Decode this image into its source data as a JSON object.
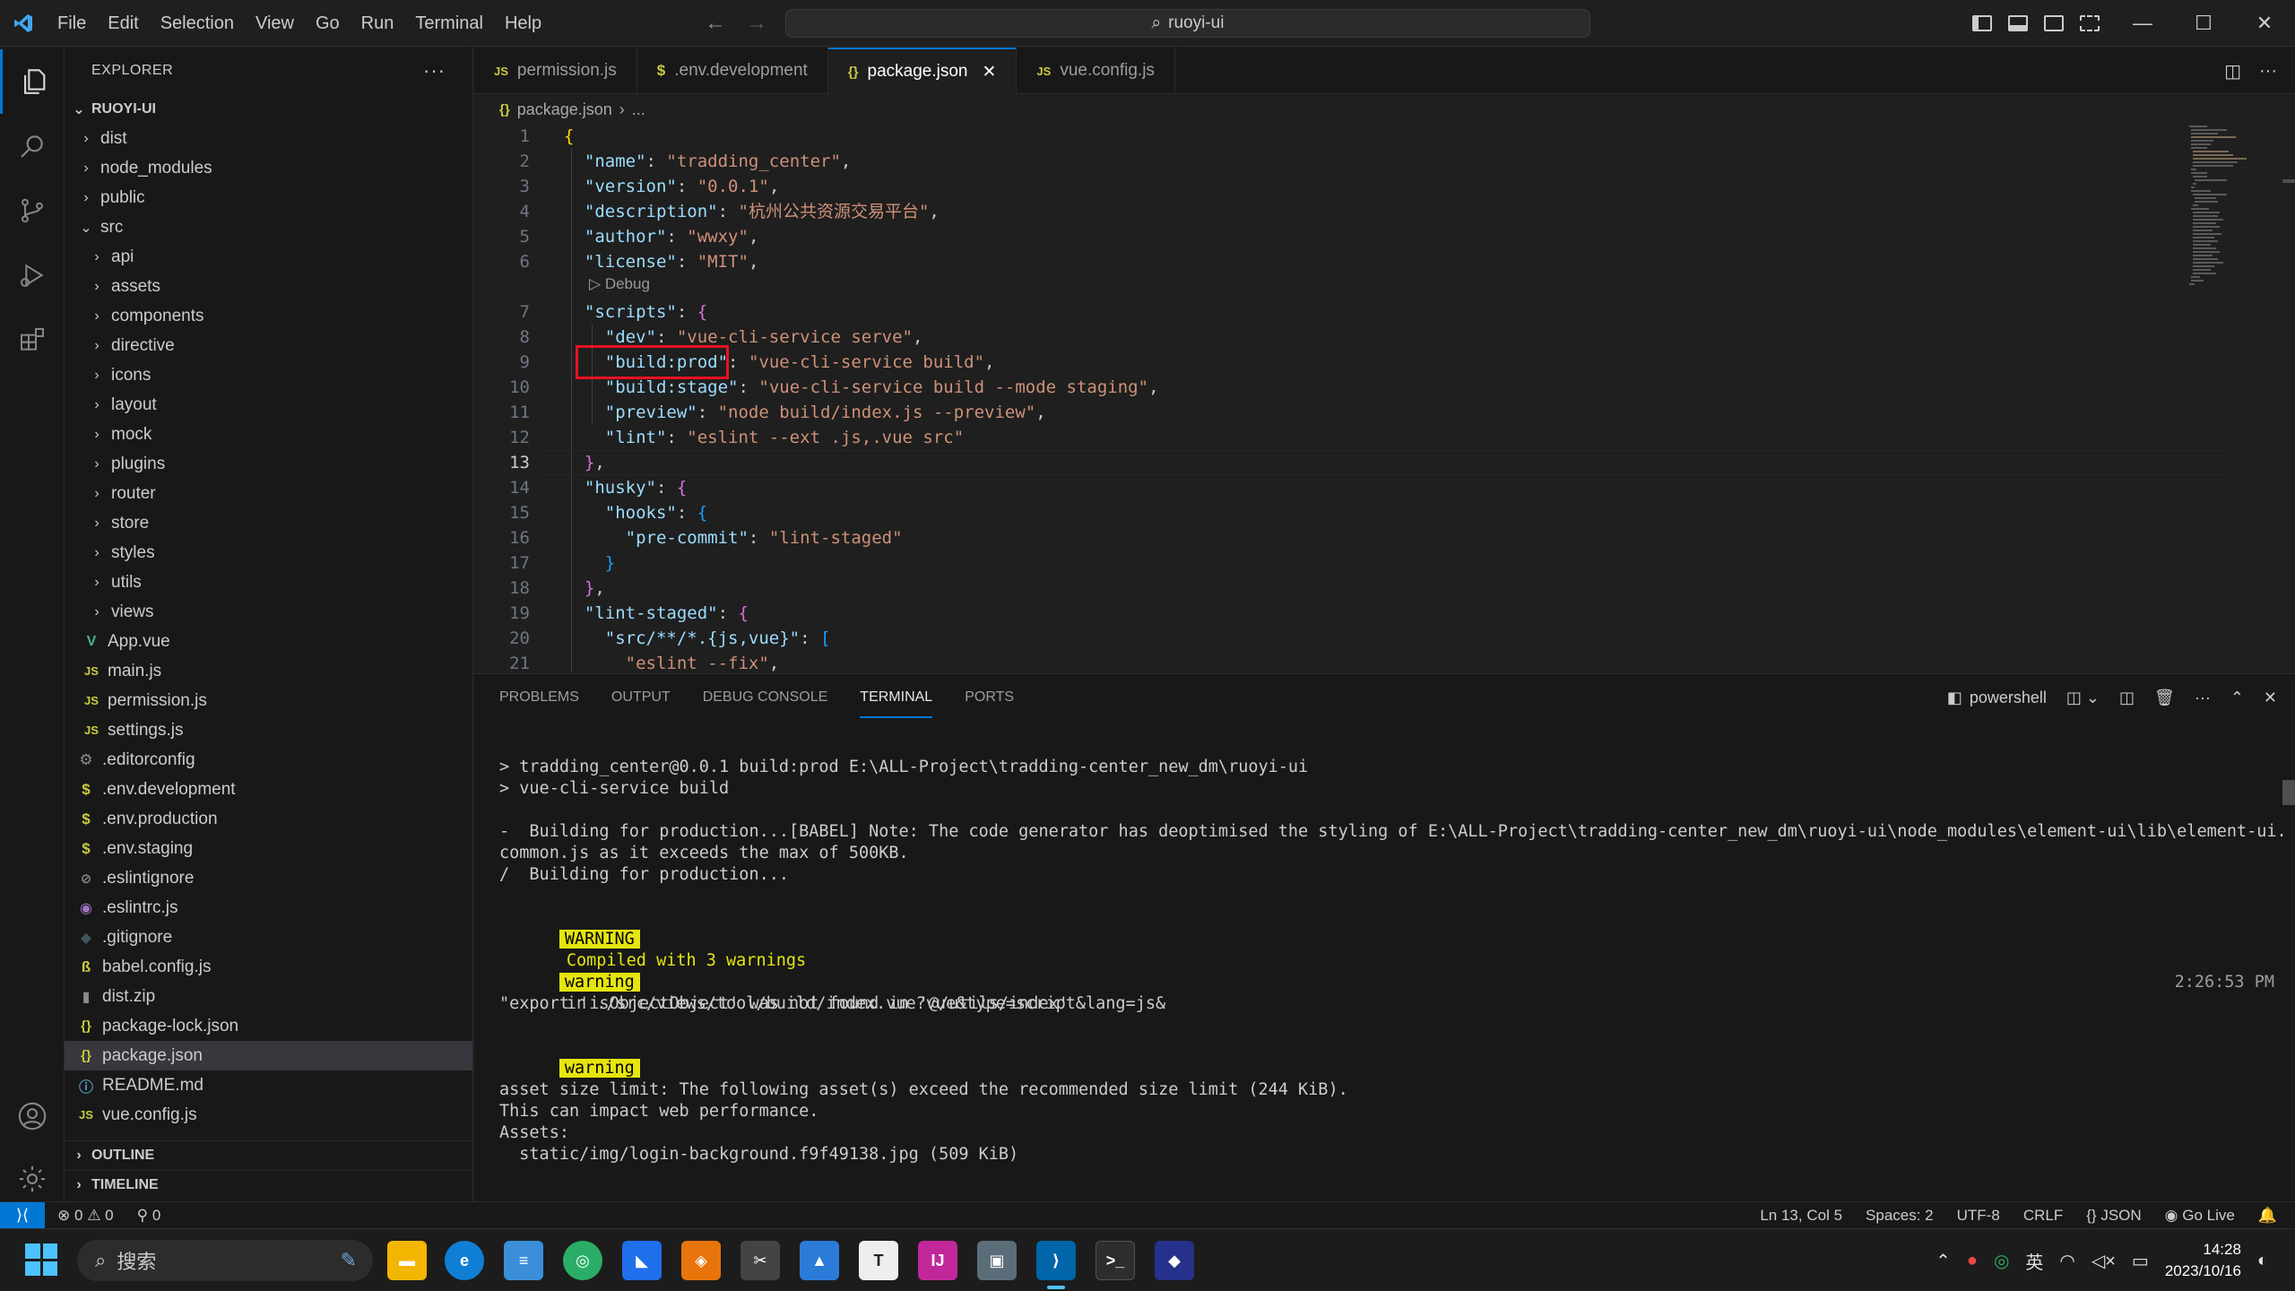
{
  "titlebar": {
    "menu": [
      "File",
      "Edit",
      "Selection",
      "View",
      "Go",
      "Run",
      "Terminal",
      "Help"
    ],
    "search_text": "ruoyi-ui"
  },
  "sidebar": {
    "title": "EXPLORER",
    "root": "RUOYI-UI",
    "items": [
      {
        "label": "dist",
        "type": "folder",
        "depth": 1
      },
      {
        "label": "node_modules",
        "type": "folder",
        "depth": 1
      },
      {
        "label": "public",
        "type": "folder",
        "depth": 1
      },
      {
        "label": "src",
        "type": "folder-open",
        "depth": 1
      },
      {
        "label": "api",
        "type": "folder",
        "depth": 2
      },
      {
        "label": "assets",
        "type": "folder",
        "depth": 2
      },
      {
        "label": "components",
        "type": "folder",
        "depth": 2
      },
      {
        "label": "directive",
        "type": "folder",
        "depth": 2
      },
      {
        "label": "icons",
        "type": "folder",
        "depth": 2
      },
      {
        "label": "layout",
        "type": "folder",
        "depth": 2
      },
      {
        "label": "mock",
        "type": "folder",
        "depth": 2
      },
      {
        "label": "plugins",
        "type": "folder",
        "depth": 2
      },
      {
        "label": "router",
        "type": "folder",
        "depth": 2
      },
      {
        "label": "store",
        "type": "folder",
        "depth": 2
      },
      {
        "label": "styles",
        "type": "folder",
        "depth": 2
      },
      {
        "label": "utils",
        "type": "folder",
        "depth": 2
      },
      {
        "label": "views",
        "type": "folder",
        "depth": 2
      },
      {
        "label": "App.vue",
        "type": "vue",
        "depth": 2
      },
      {
        "label": "main.js",
        "type": "js",
        "depth": 2
      },
      {
        "label": "permission.js",
        "type": "js",
        "depth": 2
      },
      {
        "label": "settings.js",
        "type": "js",
        "depth": 2
      },
      {
        "label": ".editorconfig",
        "type": "gear",
        "depth": 1
      },
      {
        "label": ".env.development",
        "type": "env",
        "depth": 1
      },
      {
        "label": ".env.production",
        "type": "env",
        "depth": 1
      },
      {
        "label": ".env.staging",
        "type": "env",
        "depth": 1
      },
      {
        "label": ".eslintignore",
        "type": "circle",
        "depth": 1
      },
      {
        "label": ".eslintrc.js",
        "type": "eslint",
        "depth": 1
      },
      {
        "label": ".gitignore",
        "type": "git",
        "depth": 1
      },
      {
        "label": "babel.config.js",
        "type": "babel",
        "depth": 1
      },
      {
        "label": "dist.zip",
        "type": "zip",
        "depth": 1
      },
      {
        "label": "package-lock.json",
        "type": "json",
        "depth": 1
      },
      {
        "label": "package.json",
        "type": "json",
        "depth": 1,
        "selected": true
      },
      {
        "label": "README.md",
        "type": "info",
        "depth": 1
      },
      {
        "label": "vue.config.js",
        "type": "js",
        "depth": 1
      }
    ],
    "outline": "OUTLINE",
    "timeline": "TIMELINE"
  },
  "tabs": [
    {
      "label": "permission.js",
      "icon": "JS"
    },
    {
      "label": ".env.development",
      "icon": "$"
    },
    {
      "label": "package.json",
      "icon": "{}",
      "active": true
    },
    {
      "label": "vue.config.js",
      "icon": "JS"
    }
  ],
  "breadcrumb": {
    "file": "package.json",
    "rest": "..."
  },
  "editor": {
    "codelens": "Debug",
    "lines": [
      {
        "n": "1",
        "t": [
          [
            "b1",
            "{"
          ]
        ]
      },
      {
        "n": "2",
        "t": [
          [
            "p",
            "  "
          ],
          [
            "k",
            "\"name\""
          ],
          [
            "p",
            ": "
          ],
          [
            "s",
            "\"tradding_center\""
          ],
          [
            "p",
            ","
          ]
        ]
      },
      {
        "n": "3",
        "t": [
          [
            "p",
            "  "
          ],
          [
            "k",
            "\"version\""
          ],
          [
            "p",
            ": "
          ],
          [
            "s",
            "\"0.0.1\""
          ],
          [
            "p",
            ","
          ]
        ]
      },
      {
        "n": "4",
        "t": [
          [
            "p",
            "  "
          ],
          [
            "k",
            "\"description\""
          ],
          [
            "p",
            ": "
          ],
          [
            "s",
            "\"杭州公共资源交易平台\""
          ],
          [
            "p",
            ","
          ]
        ]
      },
      {
        "n": "5",
        "t": [
          [
            "p",
            "  "
          ],
          [
            "k",
            "\"author\""
          ],
          [
            "p",
            ": "
          ],
          [
            "s",
            "\"wwxy\""
          ],
          [
            "p",
            ","
          ]
        ]
      },
      {
        "n": "6",
        "t": [
          [
            "p",
            "  "
          ],
          [
            "k",
            "\"license\""
          ],
          [
            "p",
            ": "
          ],
          [
            "s",
            "\"MIT\""
          ],
          [
            "p",
            ","
          ]
        ]
      },
      {
        "n": "7",
        "t": [
          [
            "p",
            "  "
          ],
          [
            "k",
            "\"scripts\""
          ],
          [
            "p",
            ": "
          ],
          [
            "b2",
            "{"
          ]
        ]
      },
      {
        "n": "8",
        "t": [
          [
            "p",
            "    "
          ],
          [
            "k",
            "\"dev\""
          ],
          [
            "p",
            ": "
          ],
          [
            "s",
            "\"vue-cli-service serve\""
          ],
          [
            "p",
            ","
          ]
        ]
      },
      {
        "n": "9",
        "t": [
          [
            "p",
            "    "
          ],
          [
            "k",
            "\"build:prod\""
          ],
          [
            "p",
            ": "
          ],
          [
            "s",
            "\"vue-cli-service build\""
          ],
          [
            "p",
            ","
          ]
        ]
      },
      {
        "n": "10",
        "t": [
          [
            "p",
            "    "
          ],
          [
            "k",
            "\"build:stage\""
          ],
          [
            "p",
            ": "
          ],
          [
            "s",
            "\"vue-cli-service build --mode staging\""
          ],
          [
            "p",
            ","
          ]
        ]
      },
      {
        "n": "11",
        "t": [
          [
            "p",
            "    "
          ],
          [
            "k",
            "\"preview\""
          ],
          [
            "p",
            ": "
          ],
          [
            "s",
            "\"node build/index.js --preview\""
          ],
          [
            "p",
            ","
          ]
        ]
      },
      {
        "n": "12",
        "t": [
          [
            "p",
            "    "
          ],
          [
            "k",
            "\"lint\""
          ],
          [
            "p",
            ": "
          ],
          [
            "s",
            "\"eslint --ext .js,.vue src\""
          ]
        ]
      },
      {
        "n": "13",
        "t": [
          [
            "p",
            "  "
          ],
          [
            "b2",
            "}"
          ],
          [
            "p",
            ","
          ]
        ]
      },
      {
        "n": "14",
        "t": [
          [
            "p",
            "  "
          ],
          [
            "k",
            "\"husky\""
          ],
          [
            "p",
            ": "
          ],
          [
            "b2",
            "{"
          ]
        ]
      },
      {
        "n": "15",
        "t": [
          [
            "p",
            "    "
          ],
          [
            "k",
            "\"hooks\""
          ],
          [
            "p",
            ": "
          ],
          [
            "b3",
            "{"
          ]
        ]
      },
      {
        "n": "16",
        "t": [
          [
            "p",
            "      "
          ],
          [
            "k",
            "\"pre-commit\""
          ],
          [
            "p",
            ": "
          ],
          [
            "s",
            "\"lint-staged\""
          ]
        ]
      },
      {
        "n": "17",
        "t": [
          [
            "p",
            "    "
          ],
          [
            "b3",
            "}"
          ]
        ]
      },
      {
        "n": "18",
        "t": [
          [
            "p",
            "  "
          ],
          [
            "b2",
            "}"
          ],
          [
            "p",
            ","
          ]
        ]
      },
      {
        "n": "19",
        "t": [
          [
            "p",
            "  "
          ],
          [
            "k",
            "\"lint-staged\""
          ],
          [
            "p",
            ": "
          ],
          [
            "b2",
            "{"
          ]
        ]
      },
      {
        "n": "20",
        "t": [
          [
            "p",
            "    "
          ],
          [
            "k",
            "\"src/**/*.{js,vue}\""
          ],
          [
            "p",
            ": "
          ],
          [
            "b3",
            "["
          ]
        ]
      },
      {
        "n": "21",
        "t": [
          [
            "p",
            "      "
          ],
          [
            "s",
            "\"eslint --fix\""
          ],
          [
            "p",
            ","
          ]
        ]
      }
    ]
  },
  "panel": {
    "tabs": [
      "PROBLEMS",
      "OUTPUT",
      "DEBUG CONSOLE",
      "TERMINAL",
      "PORTS"
    ],
    "active_tab": "TERMINAL",
    "shell": "powershell",
    "terminal": {
      "l1": "> tradding_center@0.0.1 build:prod E:\\ALL-Project\\tradding-center_new_dm\\ruoyi-ui",
      "l2": "> vue-cli-service build",
      "l3": "-  Building for production...[BABEL] Note: The code generator has deoptimised the styling of E:\\ALL-Project\\tradding-center_new_dm\\ruoyi-ui\\node_modules\\element-ui\\lib\\element-ui.",
      "l4": "common.js as it exceeds the max of 500KB.",
      "l5": "/  Building for production...",
      "warn_badge": "WARNING",
      "warn_text": "Compiled with 3 warnings",
      "timestamp": "2:26:53 PM",
      "w1_badge": "warning",
      "w1_text": "in ./src/views/tool/build/index.vue?vue&type=script&lang=js&",
      "w1_detail": "\"export 'isObjectObject' was not found in '@/utils/index'",
      "w2_badge": "warning",
      "w2_l1": "asset size limit: The following asset(s) exceed the recommended size limit (244 KiB).",
      "w2_l2": "This can impact web performance.",
      "w2_l3": "Assets:",
      "w2_l4": "  static/img/login-background.f9f49138.jpg (509 KiB)"
    }
  },
  "statusbar": {
    "errors": "0",
    "warnings": "0",
    "ports": "0",
    "position": "Ln 13, Col 5",
    "spaces": "Spaces: 2",
    "encoding": "UTF-8",
    "eol": "CRLF",
    "language": "JSON",
    "golive": "Go Live"
  },
  "taskbar": {
    "search": "搜索",
    "ime": "英",
    "time": "14:28",
    "date": "2023/10/16"
  }
}
